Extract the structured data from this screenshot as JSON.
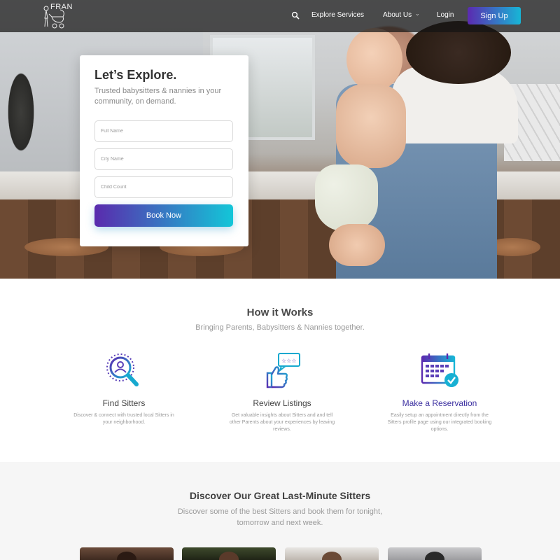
{
  "brand": {
    "logo_text": "FRAN"
  },
  "nav": {
    "explore_label": "Explore Services",
    "about_label": "About Us",
    "login_label": "Login",
    "signup_label": "Sign Up"
  },
  "booking": {
    "title": "Let’s Explore.",
    "tagline": "Trusted babysitters & nannies in your community, on demand.",
    "full_name_placeholder": "Full Name",
    "city_placeholder": "City Name",
    "child_count_placeholder": "Child Count",
    "submit_label": "Book Now"
  },
  "how_it_works": {
    "title": "How it Works",
    "subtitle": "Bringing Parents, Babysitters & Nannies together.",
    "features": [
      {
        "title": "Find Sitters",
        "desc": "Discover & connect with trusted local Sitters in your neighborhood.",
        "icon": "search-person-icon"
      },
      {
        "title": "Review Listings",
        "desc": "Get valuable insights about Sitters and and tell other Parents about your experiences by leaving reviews.",
        "icon": "thumbs-up-review-icon"
      },
      {
        "title": "Make a Reservation",
        "desc": "Easily setup an appointment directly from the Sitters profile page using our integrated booking options.",
        "icon": "calendar-check-icon"
      }
    ]
  },
  "sitters": {
    "title": "Discover Our Great Last-Minute Sitters",
    "subtitle": "Discover some of the best Sitters and book them for tonight, tomorrow and next week."
  },
  "colors": {
    "gradient_start": "#5b2ab0",
    "gradient_end": "#17b6d6",
    "reservation_title": "#3b2fa0"
  }
}
